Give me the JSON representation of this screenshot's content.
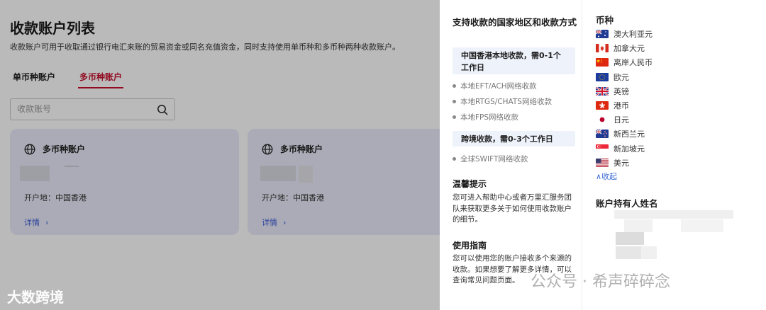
{
  "page": {
    "title": "收款账户列表",
    "description": "收款账户可用于收取通过银行电汇来账的贸易资金或同名充值资金，同时支持使用单币种和多币种两种收款账户。",
    "tabs": [
      {
        "label": "单币种账户",
        "active": false
      },
      {
        "label": "多币种账户",
        "active": true
      }
    ],
    "search_placeholder": "收款账号",
    "cards": [
      {
        "title": "多币种账户",
        "location": "开户地：中国香港",
        "detail": "详情",
        "chevron": "›"
      },
      {
        "title": "多币种账户",
        "location": "开户地：中国香港",
        "detail": "详情",
        "chevron": "›"
      }
    ]
  },
  "drawer": {
    "supported_title": "支持收款的国家地区和收款方式",
    "hk_box": "中国香港本地收款，需0-1个工作日",
    "hk_methods": [
      "本地EFT/ACH网络收款",
      "本地RTGS/CHATS网络收款",
      "本地FPS网络收款"
    ],
    "cross_box": "跨境收款，需0-3个工作日",
    "cross_methods": [
      "全球SWIFT网络收款"
    ],
    "tip_title": "温馨提示",
    "tip_text": "您可进入帮助中心或者万里汇服务团队来获取更多关于如何使用收款账户的细节。",
    "guide_title": "使用指南",
    "guide_text": "您可以使用您的账户接收多个来源的收款。如果想要了解更多详情，可以查询常见问题页面。",
    "currency_title": "币种",
    "currencies": [
      {
        "name": "澳大利亚元",
        "flag": "australia-flag"
      },
      {
        "name": "加拿大元",
        "flag": "canada-flag"
      },
      {
        "name": "离岸人民币",
        "flag": "china-flag"
      },
      {
        "name": "欧元",
        "flag": "eu-flag"
      },
      {
        "name": "英镑",
        "flag": "uk-flag"
      },
      {
        "name": "港币",
        "flag": "hongkong-flag"
      },
      {
        "name": "日元",
        "flag": "japan-flag"
      },
      {
        "name": "新西兰元",
        "flag": "newzealand-flag"
      },
      {
        "name": "新加坡元",
        "flag": "singapore-flag"
      },
      {
        "name": "美元",
        "flag": "usa-flag"
      }
    ],
    "collapse_label": "∧收起",
    "holder_title": "账户持有人姓名"
  },
  "watermarks": {
    "left": "大数跨境",
    "right": "公众号 · 希声碎碎念"
  },
  "colors": {
    "accent": "#c8102e",
    "link": "#3b5bd6",
    "card_bg": "#e9ebfa"
  }
}
